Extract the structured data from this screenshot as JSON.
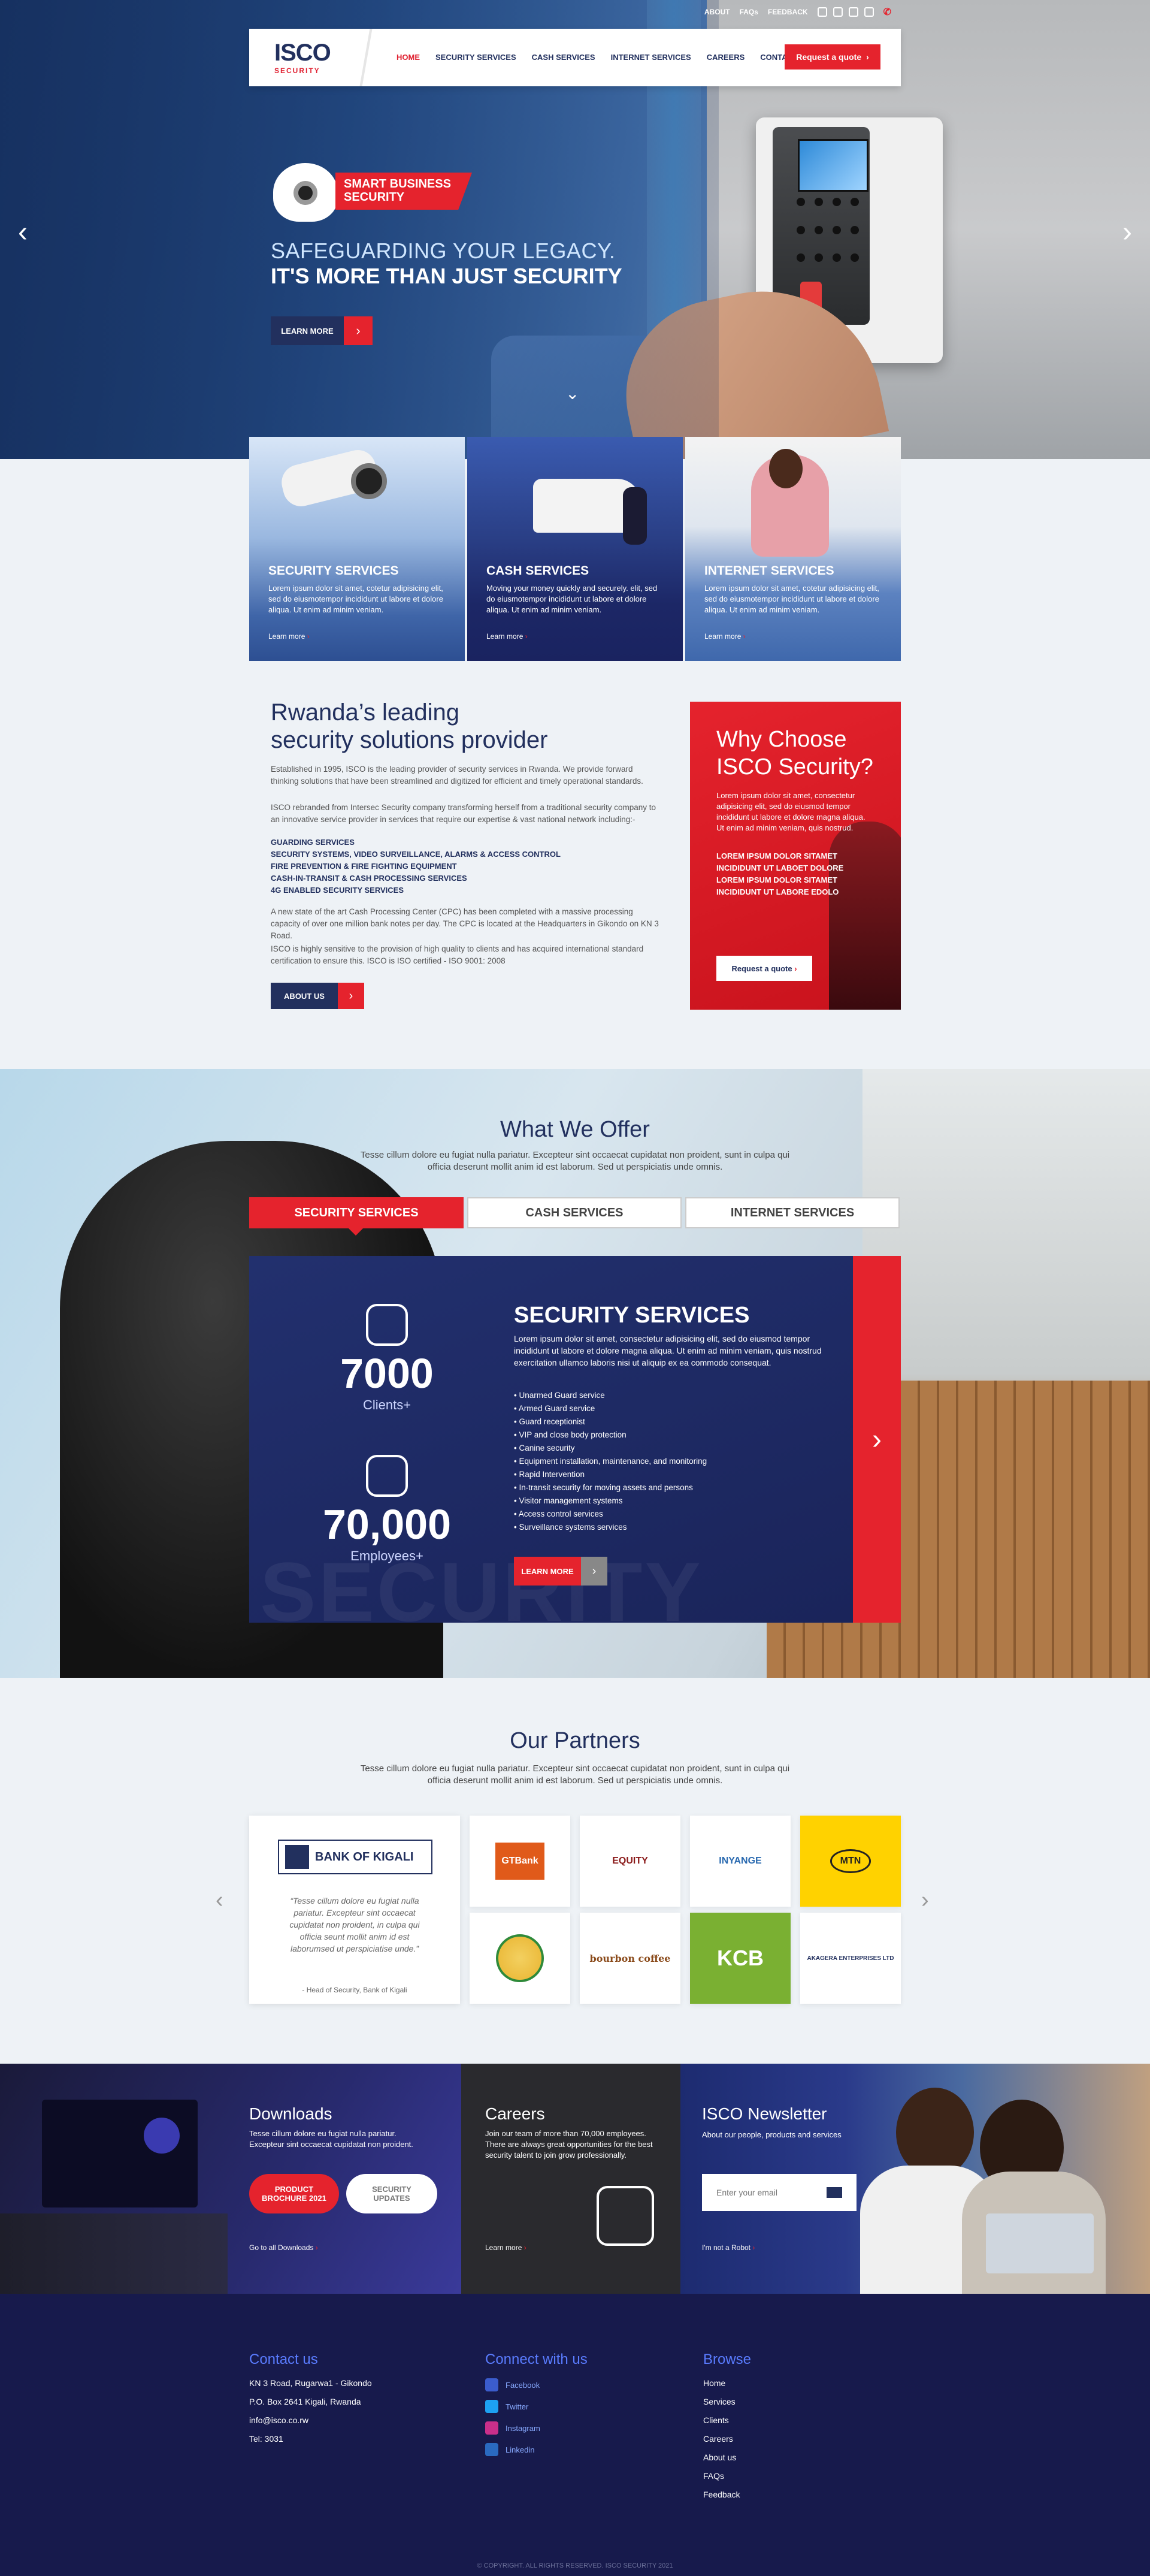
{
  "topbar": {
    "about": "ABOUT",
    "faqs": "FAQs",
    "feedback": "FEEDBACK"
  },
  "logo": {
    "text": "ISCO",
    "tagline": "SECURITY"
  },
  "nav": {
    "items": [
      "HOME",
      "SECURITY SERVICES",
      "CASH SERVICES",
      "INTERNET SERVICES",
      "CAREERS",
      "CONTACTS"
    ],
    "active": "HOME",
    "quote": "Request a quote"
  },
  "hero": {
    "badge": "SMART BUSINESS SECURITY",
    "title1": "SAFEGUARDING YOUR LEGACY.",
    "title2": "IT'S MORE THAN JUST SECURITY",
    "button": "LEARN MORE"
  },
  "cards": [
    {
      "title": "SECURITY SERVICES",
      "text": "Lorem ipsum dolor sit amet, cotetur adipisicing elit, sed do eiusmotempor incididunt ut labore et dolore aliqua. Ut enim ad minim veniam.",
      "link": "Learn more"
    },
    {
      "title": "CASH SERVICES",
      "text": "Moving your money quickly and securely. elit, sed do eiusmotempor incididunt ut labore et dolore aliqua. Ut enim ad minim veniam.",
      "link": "Learn more"
    },
    {
      "title": "INTERNET SERVICES",
      "text": "Lorem ipsum dolor sit amet, cotetur adipisicing elit, sed do eiusmotempor incididunt ut labore et dolore aliqua. Ut enim ad minim veniam.",
      "link": "Learn more"
    }
  ],
  "about": {
    "title1": "Rwanda’s leading",
    "title2": "security solutions provider",
    "p1": "Established in 1995, ISCO is the leading provider of security services in Rwanda. We provide forward thinking solutions that have been streamlined and digitized for efficient and timely operational standards.",
    "p2": "ISCO rebranded from Intersec Security company transforming herself from a traditional security company to an innovative service provider in services that require our expertise & vast national network including:-",
    "list": [
      "GUARDING SERVICES",
      "SECURITY SYSTEMS, VIDEO SURVEILLANCE, ALARMS & ACCESS CONTROL",
      "FIRE PREVENTION & FIRE FIGHTING EQUIPMENT",
      "CASH-IN-TRANSIT & CASH PROCESSING SERVICES",
      "4G ENABLED SECURITY SERVICES"
    ],
    "p3": "A new state of the art Cash Processing Center (CPC) has been completed with a massive processing capacity of over one million bank notes per day. The CPC is located at the Headquarters in Gikondo on KN 3 Road.",
    "p4": "ISCO is highly sensitive to the provision of high quality to clients and has acquired international standard certification to ensure this. ISCO is ISO certified - ISO 9001: 2008",
    "button": "ABOUT US"
  },
  "why": {
    "title1": "Why Choose",
    "title2": "ISCO Security?",
    "text": "Lorem ipsum dolor sit amet, consectetur adipisicing elit, sed do eiusmod tempor incididunt ut labore et dolore magna aliqua. Ut enim ad minim veniam, quis nostrud.",
    "list": [
      "LOREM IPSUM DOLOR SITAMET",
      "INCIDIDUNT UT LABOET DOLORE",
      "LOREM IPSUM DOLOR SITAMET",
      "INCIDIDUNT UT LABORE EDOLO"
    ],
    "button": "Request a quote"
  },
  "offer": {
    "title": "What We Offer",
    "sub": "Tesse cillum dolore eu fugiat nulla pariatur. Excepteur sint occaecat cupidatat non proident, sunt in culpa qui officia deserunt mollit anim id est laborum. Sed ut perspiciatis unde omnis.",
    "tabs": [
      "SECURITY SERVICES",
      "CASH SERVICES",
      "INTERNET SERVICES"
    ],
    "stat1": {
      "num": "7000",
      "label": "Clients+"
    },
    "stat2": {
      "num": "70,000",
      "label": "Employees+"
    },
    "heading": "SECURITY SERVICES",
    "desc": "Lorem ipsum dolor sit amet, consectetur adipisicing elit, sed do eiusmod tempor incididunt ut labore et dolore magna aliqua. Ut enim ad minim veniam, quis nostrud exercitation ullamco laboris nisi ut aliquip ex ea commodo consequat.",
    "services": [
      "Unarmed Guard service",
      "Armed Guard service",
      "Guard receptionist",
      "VIP and close body protection",
      "Canine security",
      "Equipment installation, maintenance, and monitoring",
      "Rapid Intervention",
      "In-transit security for moving assets and persons",
      "Visitor management systems",
      "Access control services",
      "Surveillance systems services"
    ],
    "button": "LEARN MORE",
    "watermark": "SECURITY"
  },
  "partners": {
    "title": "Our Partners",
    "sub": "Tesse cillum dolore eu fugiat nulla pariatur. Excepteur sint occaecat cupidatat non proident, sunt in culpa qui officia deserunt mollit anim id est laborum. Sed ut perspiciatis unde omnis.",
    "featured": {
      "name": "BANK OF KIGALI",
      "quote": "“Tesse cillum dolore eu fugiat nulla pariatur. Excepteur sint occaecat cupidatat non proident, in culpa qui officia seunt mollit anim id est laborumsed ut perspiciatise unde.”",
      "by": "- Head of Security, Bank of Kigali"
    },
    "logos": [
      "GTBank",
      "EQUITY",
      "INYANGE",
      "MTN",
      "",
      "bourbon coffee",
      "KCB",
      "AKAGERA ENTERPRISES LTD"
    ]
  },
  "downloads": {
    "title": "Downloads",
    "text": "Tesse cillum dolore eu fugiat nulla pariatur. Excepteur sint occaecat cupidatat non proident.",
    "btn1a": "PRODUCT",
    "btn1b": "BROCHURE 2021",
    "btn2a": "SECURITY",
    "btn2b": "UPDATES",
    "link": "Go to all Downloads"
  },
  "careers": {
    "title": "Careers",
    "text": "Join our team of more than 70,000 employees. There are always great opportunities for the best security talent to join grow professionally.",
    "link": "Learn more"
  },
  "newsletter": {
    "title": "ISCO Newsletter",
    "text": "About our people, products and services",
    "placeholder": "Enter your email",
    "link": "I'm not a Robot"
  },
  "footer": {
    "contact_title": "Contact us",
    "contact": [
      "KN 3 Road, Rugarwa1 - Gikondo",
      "P.O. Box 2641 Kigali, Rwanda",
      "info@isco.co.rw",
      "Tel: 3031"
    ],
    "connect_title": "Connect with us",
    "social": [
      "Facebook",
      "Twitter",
      "Instagram",
      "Linkedin"
    ],
    "browse_title": "Browse",
    "browse": [
      "Home",
      "Services",
      "Clients",
      "Careers",
      "About us",
      "FAQs",
      "Feedback"
    ],
    "copyright": "© COPYRIGHT. ALL RIGHTS RESERVED. ISCO SECURITY 2021"
  },
  "colors": {
    "brand_red": "#e5232d",
    "navy": "#22305e",
    "footer_bg": "#171a4c"
  }
}
